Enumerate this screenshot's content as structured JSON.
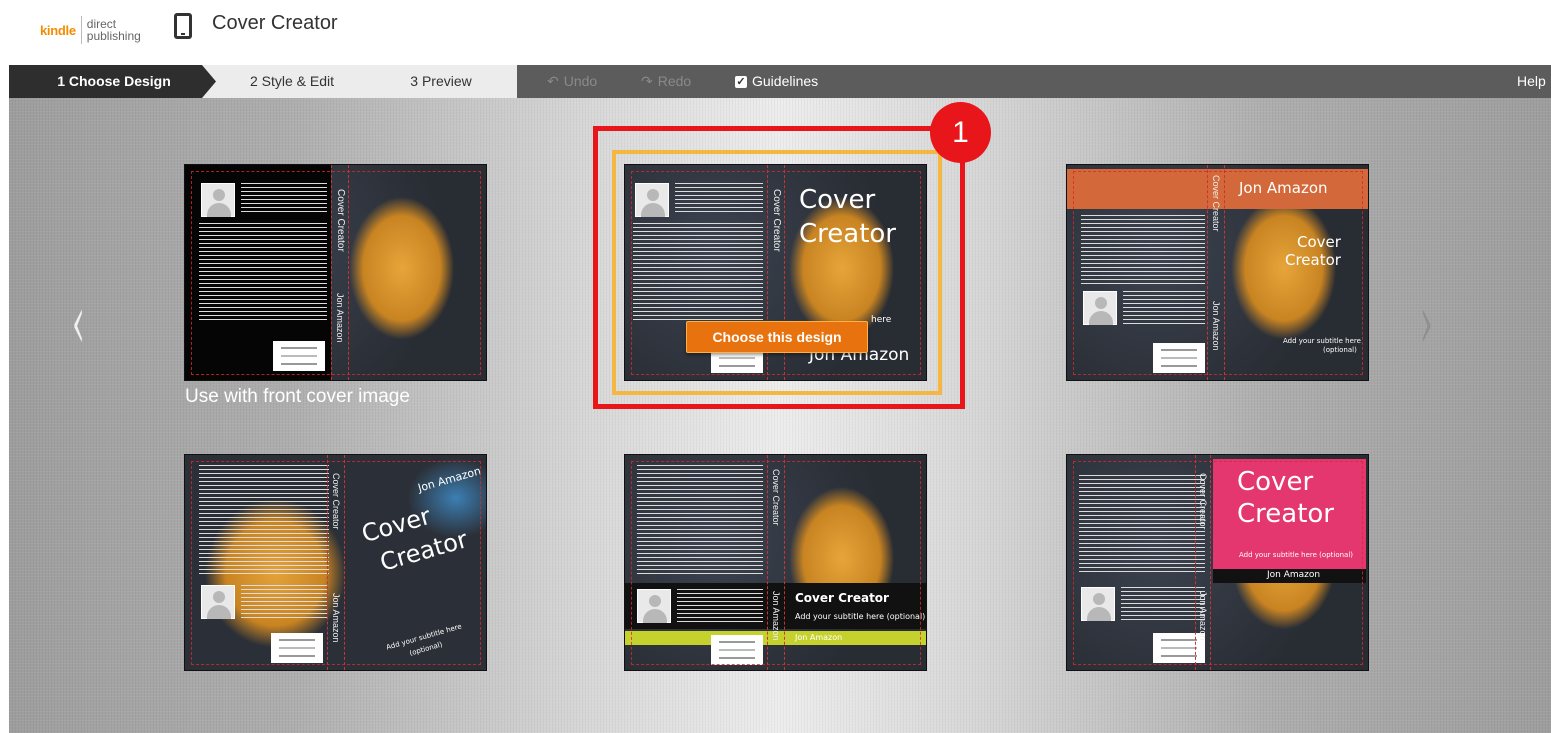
{
  "header": {
    "logo_kindle": "kindle",
    "logo_direct": "direct",
    "logo_publishing": "publishing",
    "app_title": "Cover Creator"
  },
  "toolbar": {
    "steps": [
      "1 Choose Design",
      "2 Style & Edit",
      "3 Preview"
    ],
    "undo_label": "Undo",
    "redo_label": "Redo",
    "guidelines_label": "Guidelines",
    "guidelines_checked": true,
    "help_label": "Help"
  },
  "gallery": {
    "caption": "Use with front cover image",
    "choose_button": "Choose this design",
    "badge_number": "1",
    "designs": [
      {
        "title": "Cover Creator",
        "author": "Jon Amazon",
        "spine": "Cover Creator"
      },
      {
        "title_line1": "Cover",
        "title_line2": "Creator",
        "author": "Jon Amazon",
        "spine": "Cover Creator",
        "subtitle": "here"
      },
      {
        "author": "Jon Amazon",
        "title_line1": "Cover",
        "title_line2": "Creator",
        "subtitle_line1": "Add your subtitle here",
        "subtitle_line2": "(optional)",
        "spine": "Cover Creator",
        "spine_author": "Jon Amazon"
      },
      {
        "author": "Jon Amazon",
        "title_line1": "Cover",
        "title_line2": "Creator",
        "subtitle_line1": "Add your subtitle here",
        "subtitle_line2": "(optional)",
        "spine": "Cover Creator",
        "spine_author": "Jon Amazon"
      },
      {
        "title": "Cover Creator",
        "subtitle": "Add your subtitle here (optional)",
        "author": "Jon Amazon",
        "spine": "Cover Creator",
        "spine_author": "Jon Amazon"
      },
      {
        "title_line1": "Cover",
        "title_line2": "Creator",
        "subtitle": "Add your subtitle here (optional)",
        "author": "Jon Amazon",
        "spine": "Cover Creator",
        "spine_author": "Jon Amazon"
      }
    ]
  },
  "icons": {
    "nav_prev": "‹",
    "nav_next": "›",
    "check": "✓",
    "undo": "↶",
    "redo": "↷"
  },
  "colors": {
    "selection_red": "#e8151b",
    "selection_orange": "#f5b642",
    "button_orange": "#e8720d",
    "accent_pink": "#e5376f",
    "accent_orange": "#d3693b",
    "accent_lime": "#c5d22d"
  }
}
